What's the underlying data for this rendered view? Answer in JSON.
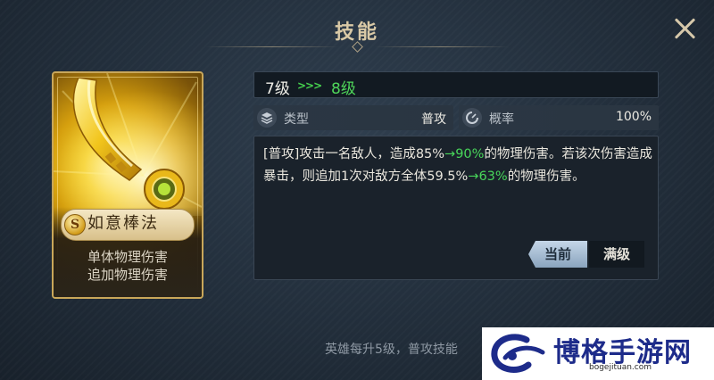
{
  "window": {
    "title": "技能"
  },
  "skill": {
    "badge": "S",
    "name": "如意棒法",
    "desc_lines": [
      "单体物理伤害",
      "追加物理伤害"
    ]
  },
  "level": {
    "current": "7级",
    "arrows": ">>>",
    "next": "8级"
  },
  "stats": {
    "type_label": "类型",
    "type_value": "普攻",
    "prob_label": "概率",
    "prob_value": "100%"
  },
  "description": {
    "p1": "[普攻]攻击一名敌人，造成85%",
    "p2": "→90%",
    "p3": "的物理伤害。若该次伤害造成暴击，则追加1次对敌方全体59.5%",
    "p4": "→63%",
    "p5": "的物理伤害。"
  },
  "tabs": {
    "current": "当前",
    "max": "满级"
  },
  "footer_tip": "英雄每升5级，普攻技能",
  "watermark": {
    "main": "博格手游网",
    "sub": "bogejituan.com"
  },
  "colors": {
    "upgrade_green": "#48d65a",
    "frame_gold": "#c9a75a"
  },
  "icons": {
    "close": "close-icon",
    "type": "layers-icon",
    "prob": "gauge-icon"
  }
}
